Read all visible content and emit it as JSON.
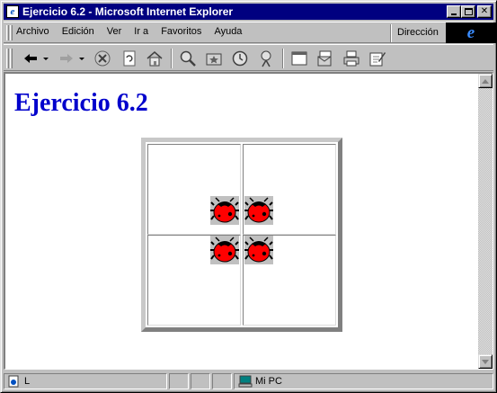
{
  "window": {
    "title": "Ejercicio 6.2 - Microsoft Internet Explorer",
    "title_icon": "ie-page-icon"
  },
  "menu": {
    "items": [
      "Archivo",
      "Edición",
      "Ver",
      "Ir a",
      "Favoritos",
      "Ayuda"
    ],
    "address_label": "Dirección"
  },
  "toolbar": {
    "buttons": [
      "back-icon",
      "forward-icon",
      "stop-icon",
      "refresh-icon",
      "home-icon",
      "search-icon",
      "favorites-icon",
      "history-icon",
      "channels-icon",
      "fullscreen-icon",
      "mail-icon",
      "print-icon",
      "edit-icon"
    ]
  },
  "page": {
    "heading": "Ejercicio 6.2",
    "table": {
      "rows": 2,
      "cols": 2,
      "bug_images": [
        "ladybug-image",
        "ladybug-image",
        "ladybug-image",
        "ladybug-image"
      ]
    }
  },
  "statusbar": {
    "text": "L",
    "zone_label": "Mi PC"
  },
  "colors": {
    "titlebar": "#000080",
    "heading": "#0000cc",
    "chrome": "#c0c0c0",
    "bug_red": "#ff0000"
  }
}
